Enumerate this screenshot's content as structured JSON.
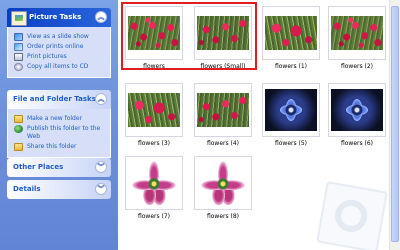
{
  "taskpane": {
    "picture_tasks": {
      "title": "Picture Tasks",
      "items": [
        {
          "label": "View as a slide show",
          "icon": "slideshow-icon"
        },
        {
          "label": "Order prints online",
          "icon": "order-prints-icon"
        },
        {
          "label": "Print pictures",
          "icon": "printer-icon"
        },
        {
          "label": "Copy all items to CD",
          "icon": "cd-icon"
        }
      ]
    },
    "file_folder_tasks": {
      "title": "File and Folder Tasks",
      "items": [
        {
          "label": "Make a new folder",
          "icon": "new-folder-icon"
        },
        {
          "label": "Publish this folder to the Web",
          "icon": "publish-web-icon"
        },
        {
          "label": "Share this folder",
          "icon": "share-folder-icon"
        }
      ]
    },
    "other_places": {
      "title": "Other Places"
    },
    "details": {
      "title": "Details"
    }
  },
  "thumbnails": [
    {
      "name": "flowers",
      "type": "red"
    },
    {
      "name": "flowers (Small)",
      "type": "red"
    },
    {
      "name": "flowers (1)",
      "type": "red"
    },
    {
      "name": "flowers (2)",
      "type": "red"
    },
    {
      "name": "flowers (3)",
      "type": "red"
    },
    {
      "name": "flowers (4)",
      "type": "red"
    },
    {
      "name": "flowers (5)",
      "type": "blue"
    },
    {
      "name": "flowers (6)",
      "type": "blue"
    },
    {
      "name": "flowers (7)",
      "type": "pink"
    },
    {
      "name": "flowers (8)",
      "type": "pink"
    }
  ],
  "colors": {
    "selection_highlight": "#e31b22",
    "taskpane_blue": "#6b8fdc",
    "link_blue": "#215dc6"
  }
}
